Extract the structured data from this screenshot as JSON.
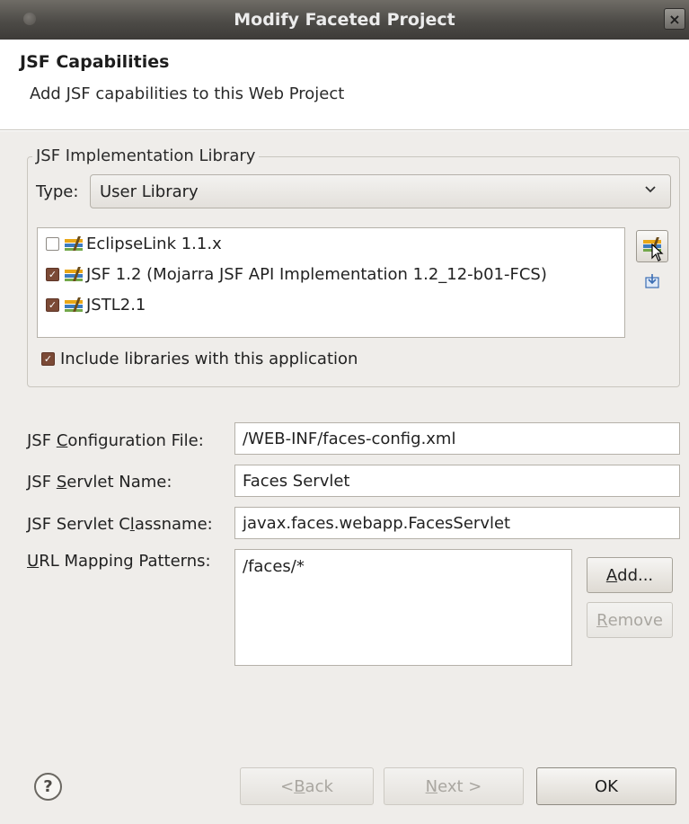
{
  "window": {
    "title": "Modify Faceted Project",
    "close_glyph": "×"
  },
  "header": {
    "title": "JSF Capabilities",
    "description": "Add JSF capabilities to this Web Project"
  },
  "library_group": {
    "legend": "JSF Implementation Library",
    "type_label": "Type:",
    "type_value": "User Library",
    "items": [
      {
        "label": "EclipseLink 1.1.x",
        "checked": false
      },
      {
        "label": "JSF 1.2 (Mojarra JSF API Implementation 1.2_12-b01-FCS)",
        "checked": true
      },
      {
        "label": "JSTL2.1",
        "checked": true
      }
    ],
    "include_label": "Include libraries with this application",
    "include_checked": true
  },
  "form": {
    "config_file_label_pre": "JSF ",
    "config_file_label_mnemonic": "C",
    "config_file_label_post": "onfiguration File:",
    "config_file_value": "/WEB-INF/faces-config.xml",
    "servlet_name_label_pre": "JSF ",
    "servlet_name_label_mnemonic": "S",
    "servlet_name_label_post": "ervlet Name:",
    "servlet_name_value": "Faces Servlet",
    "servlet_class_label_pre": "JSF Servlet C",
    "servlet_class_label_mnemonic": "l",
    "servlet_class_label_post": "assname:",
    "servlet_class_value": "javax.faces.webapp.FacesServlet",
    "url_label_mnemonic": "U",
    "url_label_post": "RL Mapping Patterns:",
    "url_patterns": [
      "/faces/*"
    ],
    "add_mnemonic": "A",
    "add_post": "dd...",
    "remove_mnemonic": "R",
    "remove_post": "emove"
  },
  "footer": {
    "help_glyph": "?",
    "back_pre": "< ",
    "back_mnemonic": "B",
    "back_post": "ack",
    "next_mnemonic": "N",
    "next_post": "ext >",
    "ok_label": "OK"
  },
  "icons": {
    "library": "jar-library-icon",
    "manage": "manage-libraries-icon",
    "download": "download-library-icon",
    "help": "help-icon"
  }
}
